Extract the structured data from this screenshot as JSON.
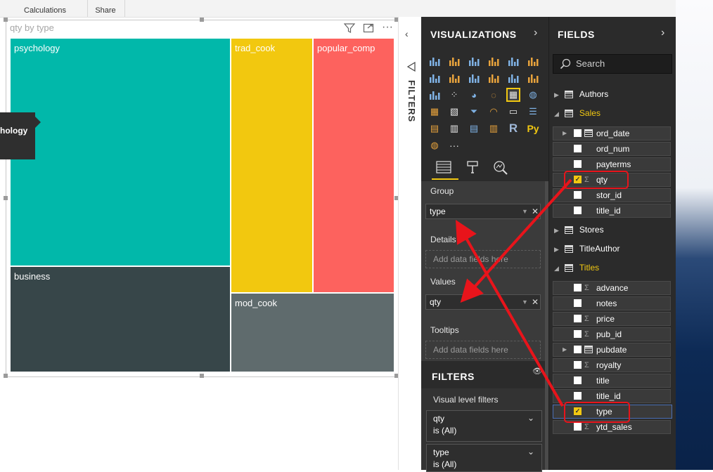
{
  "ribbon": {
    "groups": [
      "Calculations",
      "Share"
    ]
  },
  "visual": {
    "title": "qty by type",
    "tooltip_text": "hology",
    "tiles": [
      {
        "label": "psychology",
        "color": "#01b8aa"
      },
      {
        "label": "business",
        "color": "#374649"
      },
      {
        "label": "trad_cook",
        "color": "#f2c80f"
      },
      {
        "label": "popular_comp",
        "color": "#fd625e"
      },
      {
        "label": "mod_cook",
        "color": "#5f6b6d"
      }
    ]
  },
  "filters_strip": {
    "label": "FILTERS"
  },
  "visualizations": {
    "title": "VISUALIZATIONS",
    "icons": [
      "stacked-bar-chart-icon",
      "stacked-column-chart-icon",
      "clustered-bar-chart-icon",
      "clustered-column-chart-icon",
      "100-bar-chart-icon",
      "100-column-chart-icon",
      "line-chart-icon",
      "area-chart-icon",
      "stacked-area-chart-icon",
      "line-column-chart-icon",
      "line-stacked-column-chart-icon",
      "ribbon-chart-icon",
      "waterfall-chart-icon",
      "scatter-chart-icon",
      "pie-chart-icon",
      "donut-chart-icon",
      "treemap-icon",
      "map-icon",
      "filled-map-icon",
      "shape-map-icon",
      "funnel-icon",
      "gauge-icon",
      "card-icon",
      "multi-row-card-icon",
      "kpi-icon",
      "slicer-icon",
      "table-icon",
      "matrix-icon",
      "r-visual-icon",
      "python-visual-icon",
      "arcgis-icon",
      "more-icon"
    ],
    "r_label": "R",
    "py_label": "Py",
    "more_label": "···",
    "wells": {
      "group_label": "Group",
      "group_value": "type",
      "details_label": "Details",
      "details_placeholder": "Add data fields here",
      "values_label": "Values",
      "values_value": "qty",
      "tooltips_label": "Tooltips",
      "tooltips_placeholder": "Add data fields here"
    },
    "filters": {
      "title": "FILTERS",
      "visual_level": "Visual level filters",
      "cards": [
        {
          "field": "qty",
          "state": "is (All)"
        },
        {
          "field": "type",
          "state": "is (All)"
        }
      ]
    }
  },
  "fields": {
    "title": "FIELDS",
    "search_placeholder": "Search",
    "tables": {
      "authors": "Authors",
      "sales": "Sales",
      "stores": "Stores",
      "titleauthor": "TitleAuthor",
      "titles": "Titles"
    },
    "sales_fields": [
      {
        "name": "ord_date",
        "checked": false,
        "sigma": false,
        "date": true
      },
      {
        "name": "ord_num",
        "checked": false,
        "sigma": false
      },
      {
        "name": "payterms",
        "checked": false,
        "sigma": false
      },
      {
        "name": "qty",
        "checked": true,
        "sigma": true
      },
      {
        "name": "stor_id",
        "checked": false,
        "sigma": false
      },
      {
        "name": "title_id",
        "checked": false,
        "sigma": false
      }
    ],
    "titles_fields": [
      {
        "name": "advance",
        "checked": false,
        "sigma": true
      },
      {
        "name": "notes",
        "checked": false,
        "sigma": false
      },
      {
        "name": "price",
        "checked": false,
        "sigma": true
      },
      {
        "name": "pub_id",
        "checked": false,
        "sigma": true
      },
      {
        "name": "pubdate",
        "checked": false,
        "sigma": false,
        "date": true
      },
      {
        "name": "royalty",
        "checked": false,
        "sigma": true
      },
      {
        "name": "title",
        "checked": false,
        "sigma": false
      },
      {
        "name": "title_id",
        "checked": false,
        "sigma": false
      },
      {
        "name": "type",
        "checked": true,
        "sigma": false
      },
      {
        "name": "ytd_sales",
        "checked": false,
        "sigma": true
      }
    ]
  },
  "colors": {
    "accent": "#f2c811",
    "annotation": "#e8141b"
  }
}
